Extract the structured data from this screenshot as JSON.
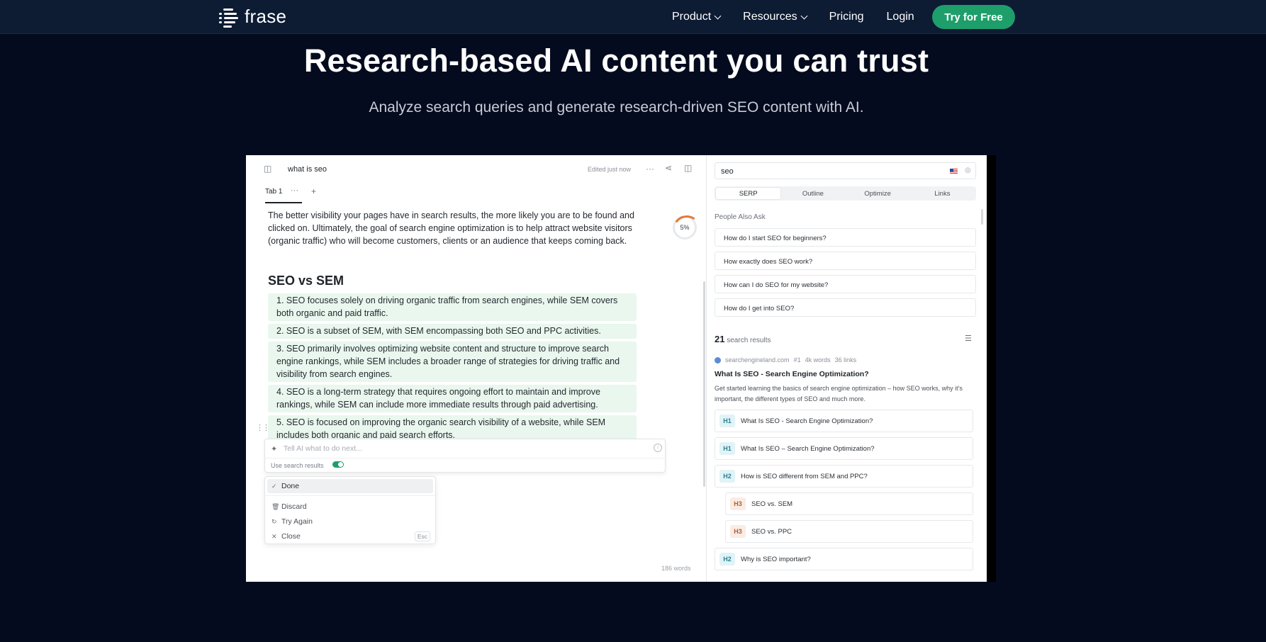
{
  "nav": {
    "logo_text": "frase",
    "links": [
      {
        "label": "Product",
        "dropdown": true
      },
      {
        "label": "Resources",
        "dropdown": true
      },
      {
        "label": "Pricing",
        "dropdown": false
      },
      {
        "label": "Login",
        "dropdown": false
      }
    ],
    "cta": "Try for Free"
  },
  "hero": {
    "title": "Research-based AI content you can trust",
    "subtitle": "Analyze search queries and generate research-driven SEO content with AI."
  },
  "editor": {
    "doc_title": "what is seo",
    "edited": "Edited just now",
    "tab": "Tab 1",
    "tab_more": "···",
    "tab_add": "+",
    "paragraph": "The better visibility your pages have in search results, the more likely you are to be found and clicked on. Ultimately, the goal of search engine optimization is to help attract website visitors (organic traffic) who will become customers, clients or an audience that keeps coming back.",
    "progress": "5%",
    "heading": "SEO vs SEM",
    "list": [
      "1. SEO focuses solely on driving organic traffic from search engines, while SEM covers both organic and paid traffic.",
      "2. SEO is a subset of SEM, with SEM encompassing both SEO and PPC activities.",
      "3. SEO primarily involves optimizing website content and structure to improve search engine rankings, while SEM includes a broader range of strategies for driving traffic and visibility from search engines.",
      "4. SEO is a long-term strategy that requires ongoing effort to maintain and improve rankings, while SEM can include more immediate results through paid advertising.",
      "5. SEO is focused on improving the organic search visibility of a website, while SEM includes both organic and paid search efforts."
    ],
    "ai_placeholder": "Tell AI what to do next...",
    "use_search_results": "Use search results",
    "menu": {
      "done": "Done",
      "discard": "Discard",
      "try_again": "Try Again",
      "close": "Close",
      "close_key": "Esc"
    },
    "word_count": "186 words"
  },
  "panel": {
    "query": "seo",
    "tabs": [
      "SERP",
      "Outline",
      "Optimize",
      "Links"
    ],
    "active_tab": "SERP",
    "paa_heading": "People Also Ask",
    "paa": [
      "How do I start SEO for beginners?",
      "How exactly does SEO work?",
      "How can I do SEO for my website?",
      "How do I get into SEO?"
    ],
    "results_count": "21",
    "results_label": "search results",
    "result": {
      "domain": "searchengineland.com",
      "rank": "#1",
      "words": "4k words",
      "links": "36 links",
      "title": "What Is SEO - Search Engine Optimization?",
      "description": "Get started learning the basics of search engine optimization – how SEO works, why it's important, the different types of SEO and much more."
    },
    "headings": [
      {
        "tag": "H1",
        "text": "What Is SEO - Search Engine Optimization?"
      },
      {
        "tag": "H1",
        "text": "What Is SEO – Search Engine Optimization?"
      },
      {
        "tag": "H2",
        "text": "How is SEO different from SEM and PPC?"
      },
      {
        "tag": "H3",
        "text": "SEO vs. SEM"
      },
      {
        "tag": "H3",
        "text": "SEO vs. PPC"
      },
      {
        "tag": "H2",
        "text": "Why is SEO important?"
      }
    ]
  },
  "colors": {
    "page_bg": "#050b1e",
    "nav_bg": "#0d1b33",
    "cta_green": "#1e9e6a",
    "list_highlight": "#e9f7ee"
  }
}
